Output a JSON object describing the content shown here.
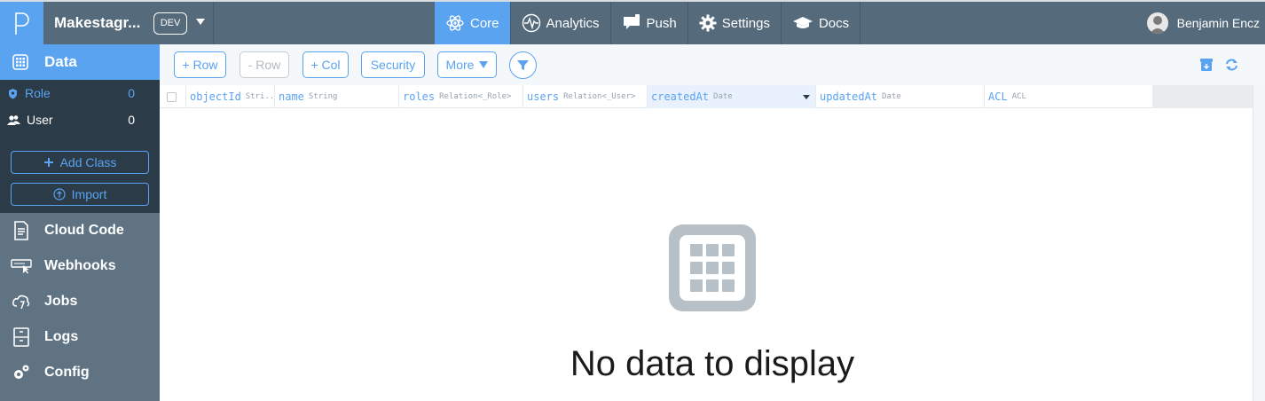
{
  "header": {
    "app_name": "Makestagr...",
    "env": "DEV",
    "nav": [
      {
        "label": "Core",
        "icon": "core-icon",
        "active": true
      },
      {
        "label": "Analytics",
        "icon": "analytics-icon",
        "active": false
      },
      {
        "label": "Push",
        "icon": "push-icon",
        "active": false
      },
      {
        "label": "Settings",
        "icon": "gear-icon",
        "active": false
      },
      {
        "label": "Docs",
        "icon": "docs-icon",
        "active": false
      }
    ],
    "user_name": "Benjamin Encz"
  },
  "sidebar": {
    "data_label": "Data",
    "classes": [
      {
        "name": "Role",
        "count": "0",
        "active": true
      },
      {
        "name": "User",
        "count": "0",
        "active": false
      }
    ],
    "add_class": "Add Class",
    "import": "Import",
    "links": [
      {
        "label": "Cloud Code",
        "icon": "cloud-code-icon"
      },
      {
        "label": "Webhooks",
        "icon": "webhooks-icon"
      },
      {
        "label": "Jobs",
        "icon": "jobs-icon"
      },
      {
        "label": "Logs",
        "icon": "logs-icon"
      },
      {
        "label": "Config",
        "icon": "config-icon"
      }
    ]
  },
  "toolbar": {
    "add_row": "+ Row",
    "remove_row": "- Row",
    "add_col": "+ Col",
    "security": "Security",
    "more": "More"
  },
  "table": {
    "columns": [
      {
        "name": "objectId",
        "type": "Stri..."
      },
      {
        "name": "name",
        "type": "String"
      },
      {
        "name": "roles",
        "type": "Relation<_Role>"
      },
      {
        "name": "users",
        "type": "Relation<_User>"
      },
      {
        "name": "createdAt",
        "type": "Date"
      },
      {
        "name": "updatedAt",
        "type": "Date"
      },
      {
        "name": "ACL",
        "type": "ACL"
      }
    ],
    "sorted_column": "createdAt"
  },
  "empty_state": {
    "message": "No data to display"
  },
  "colors": {
    "accent": "#5aa3f0",
    "topbar": "#556a7b",
    "sidebar": "#5f7383",
    "sidebar_dark": "#2b3b48"
  }
}
